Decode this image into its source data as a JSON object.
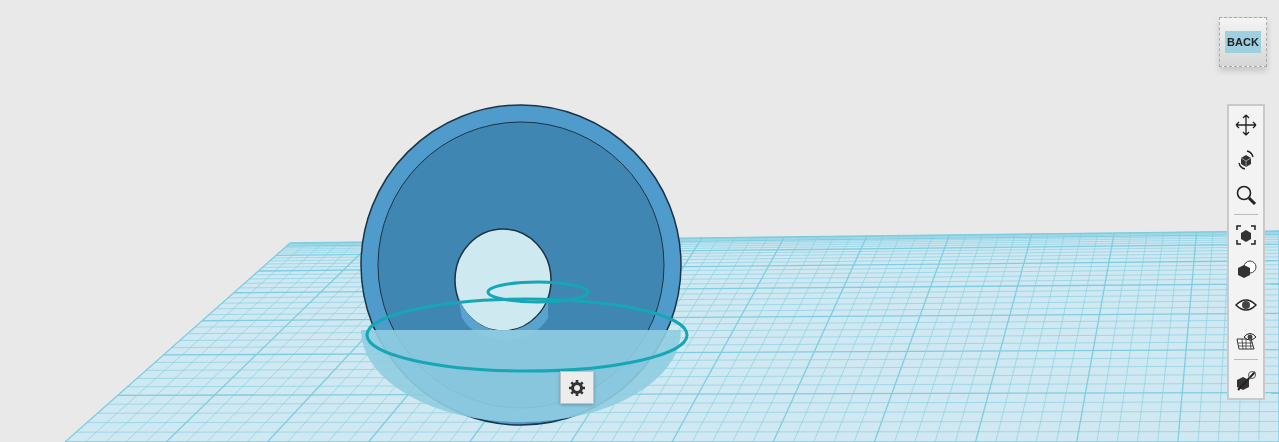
{
  "view_cube": {
    "face_label": "BACK"
  },
  "navigation_toolbar": {
    "groups": [
      {
        "items": [
          {
            "kind": "pan"
          },
          {
            "kind": "orbit"
          },
          {
            "kind": "zoom"
          }
        ]
      },
      {
        "items": [
          {
            "kind": "fit"
          },
          {
            "kind": "perspective"
          },
          {
            "kind": "visibility"
          },
          {
            "kind": "grid_visibility"
          }
        ]
      },
      {
        "items": [
          {
            "kind": "hide_model"
          }
        ]
      }
    ]
  },
  "context_button": {
    "kind": "settings"
  }
}
